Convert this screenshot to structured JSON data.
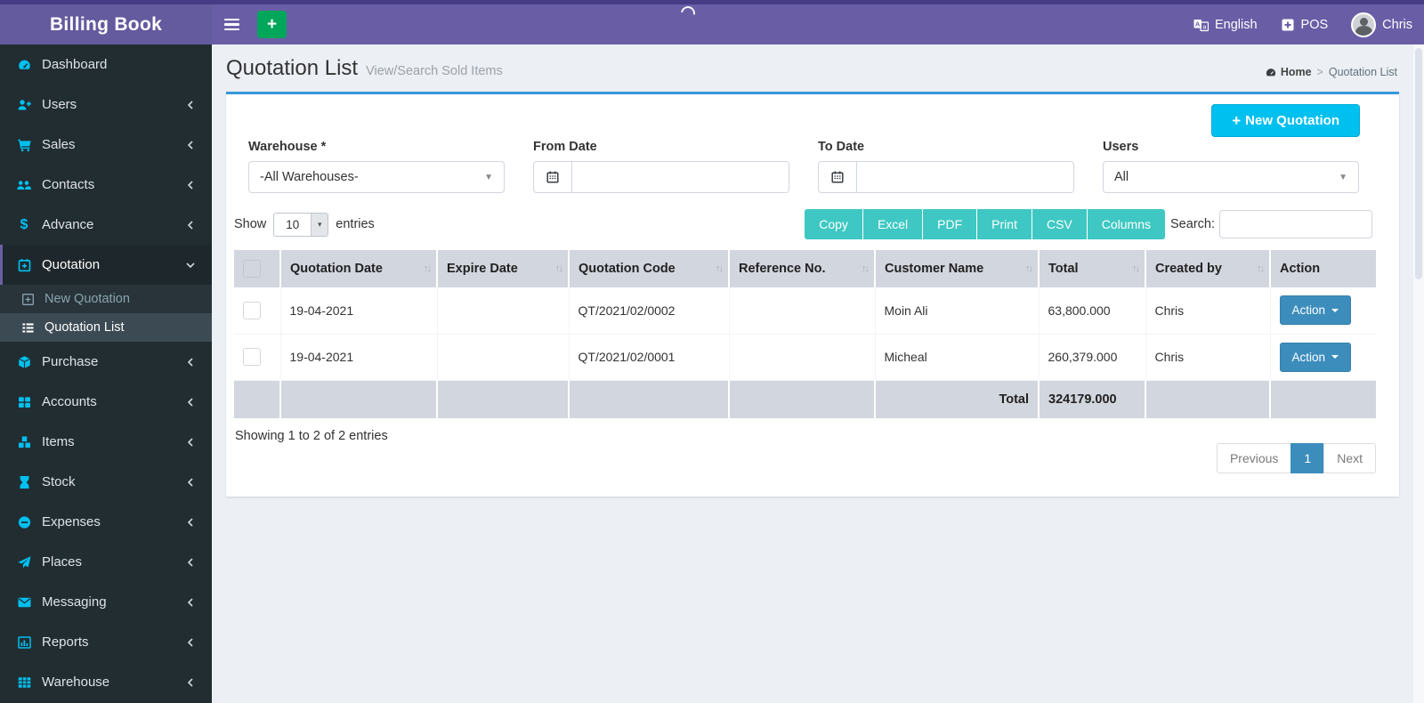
{
  "colors": {
    "header_purple": "#695ea6",
    "header_strip": "#463c85",
    "sidebar_bg": "#222d32",
    "sidebar_icon": "#00c0ef",
    "accent_aqua": "#00c0ef",
    "accent_teal": "#3fc8c3",
    "accent_primary": "#3c8dbc",
    "accent_green": "#00a65a",
    "table_header_bg": "#d2d6de",
    "card_top_border": "#3598db",
    "content_bg": "#ecf0f5"
  },
  "app": {
    "name": "Billing Book"
  },
  "topbar": {
    "hamburger_icon": "bars-icon",
    "quick_add_icon": "plus-icon",
    "spinner_icon": "loading-spinner",
    "language": {
      "label": "English",
      "icon": "language-icon"
    },
    "pos": {
      "label": "POS",
      "icon": "plus-square-icon"
    },
    "user": {
      "label": "Chris",
      "icon": "avatar"
    }
  },
  "sidebar": {
    "items": [
      {
        "label": "Dashboard",
        "icon": "gauge-icon"
      },
      {
        "label": "Users",
        "icon": "user-plus-icon"
      },
      {
        "label": "Sales",
        "icon": "cart-icon"
      },
      {
        "label": "Contacts",
        "icon": "users-icon"
      },
      {
        "label": "Advance",
        "icon": "dollar-icon"
      },
      {
        "label": "Quotation",
        "icon": "calendar-plus-icon",
        "expanded": true,
        "children": [
          {
            "label": "New Quotation",
            "icon": "plus-square-icon"
          },
          {
            "label": "Quotation List",
            "icon": "list-icon",
            "active": true
          }
        ]
      },
      {
        "label": "Purchase",
        "icon": "cube-icon"
      },
      {
        "label": "Accounts",
        "icon": "grid-icon"
      },
      {
        "label": "Items",
        "icon": "cubes-icon"
      },
      {
        "label": "Stock",
        "icon": "hourglass-icon"
      },
      {
        "label": "Expenses",
        "icon": "minus-circle-icon"
      },
      {
        "label": "Places",
        "icon": "paper-plane-icon"
      },
      {
        "label": "Messaging",
        "icon": "envelope-icon"
      },
      {
        "label": "Reports",
        "icon": "bar-chart-icon"
      },
      {
        "label": "Warehouse",
        "icon": "table-grid-icon"
      }
    ]
  },
  "page": {
    "title": "Quotation List",
    "subtitle": "View/Search Sold Items",
    "breadcrumb": {
      "icon": "gauge-icon",
      "home": "Home",
      "separator": ">",
      "current": "Quotation List"
    }
  },
  "filters": {
    "warehouse": {
      "label": "Warehouse *",
      "value": "-All Warehouses-"
    },
    "from_date": {
      "label": "From Date",
      "value": "",
      "icon": "calendar-icon"
    },
    "to_date": {
      "label": "To Date",
      "value": "",
      "icon": "calendar-icon"
    },
    "users": {
      "label": "Users",
      "value": "All"
    }
  },
  "actions": {
    "new_quotation": "New Quotation",
    "row_action": "Action"
  },
  "datatable": {
    "show_label": "Show",
    "page_length": "10",
    "entries_label": "entries",
    "export_buttons": [
      "Copy",
      "Excel",
      "PDF",
      "Print",
      "CSV",
      "Columns"
    ],
    "search_label": "Search:",
    "search_value": "",
    "columns": [
      "Quotation Date",
      "Expire Date",
      "Quotation Code",
      "Reference No.",
      "Customer Name",
      "Total",
      "Created by",
      "Action"
    ],
    "rows": [
      {
        "quotation_date": "19-04-2021",
        "expire_date": "",
        "quotation_code": "QT/2021/02/0002",
        "reference_no": "",
        "customer_name": "Moin Ali",
        "total": "63,800.000",
        "created_by": "Chris"
      },
      {
        "quotation_date": "19-04-2021",
        "expire_date": "",
        "quotation_code": "QT/2021/02/0001",
        "reference_no": "",
        "customer_name": "Micheal",
        "total": "260,379.000",
        "created_by": "Chris"
      }
    ],
    "footer_total_label": "Total",
    "footer_total_value": "324179.000",
    "summary": "Showing 1 to 2 of 2 entries",
    "pagination": {
      "previous": "Previous",
      "current": "1",
      "next": "Next"
    }
  }
}
